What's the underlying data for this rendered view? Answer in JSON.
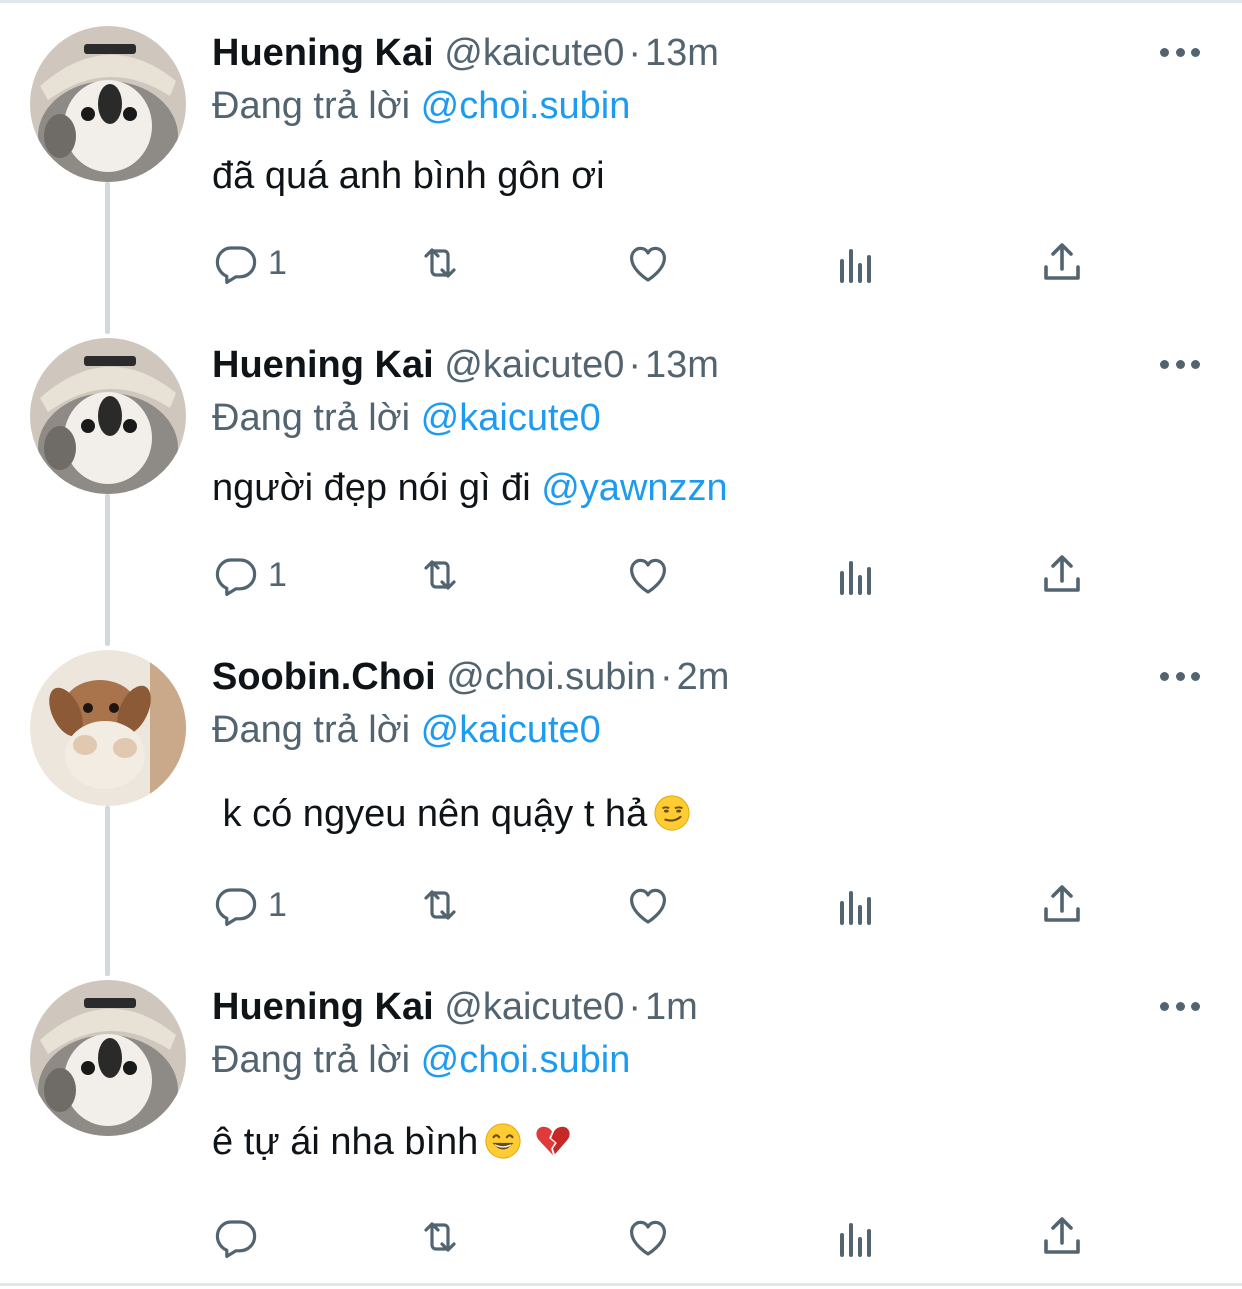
{
  "reply_prefix": "Đang trả lời",
  "tweets": [
    {
      "name": "Huening Kai",
      "handle": "@kaicute0",
      "separator": "·",
      "time": "13m",
      "replying_to": "@choi.subin",
      "text": "đã quá anh bình gôn ơi",
      "mention": "",
      "reply_count": "1",
      "avatar": "penguin-avatar"
    },
    {
      "name": "Huening Kai",
      "handle": "@kaicute0",
      "separator": "·",
      "time": "13m",
      "replying_to": "@kaicute0",
      "text": "người đẹp nói gì đi ",
      "mention": "@yawnzzn",
      "reply_count": "1",
      "avatar": "penguin-avatar"
    },
    {
      "name": "Soobin.Choi",
      "handle": "@choi.subin",
      "separator": "·",
      "time": "2m",
      "replying_to": "@kaicute0",
      "text": " k có ngyeu nên quậy t hả",
      "mention": "",
      "reply_count": "1",
      "avatar": "bunny-avatar",
      "emojis": [
        "smirk-emoji"
      ]
    },
    {
      "name": "Huening Kai",
      "handle": "@kaicute0",
      "separator": "·",
      "time": "1m",
      "replying_to": "@choi.subin",
      "text": "ê tự ái nha bình",
      "mention": "",
      "reply_count": "",
      "avatar": "penguin-avatar",
      "emojis": [
        "grin-emoji",
        "broken-heart-emoji"
      ]
    }
  ],
  "colors": {
    "text": "#0f1419",
    "secondary": "#536471",
    "link": "#1d9bf0",
    "thread_line": "#cfd9de"
  }
}
